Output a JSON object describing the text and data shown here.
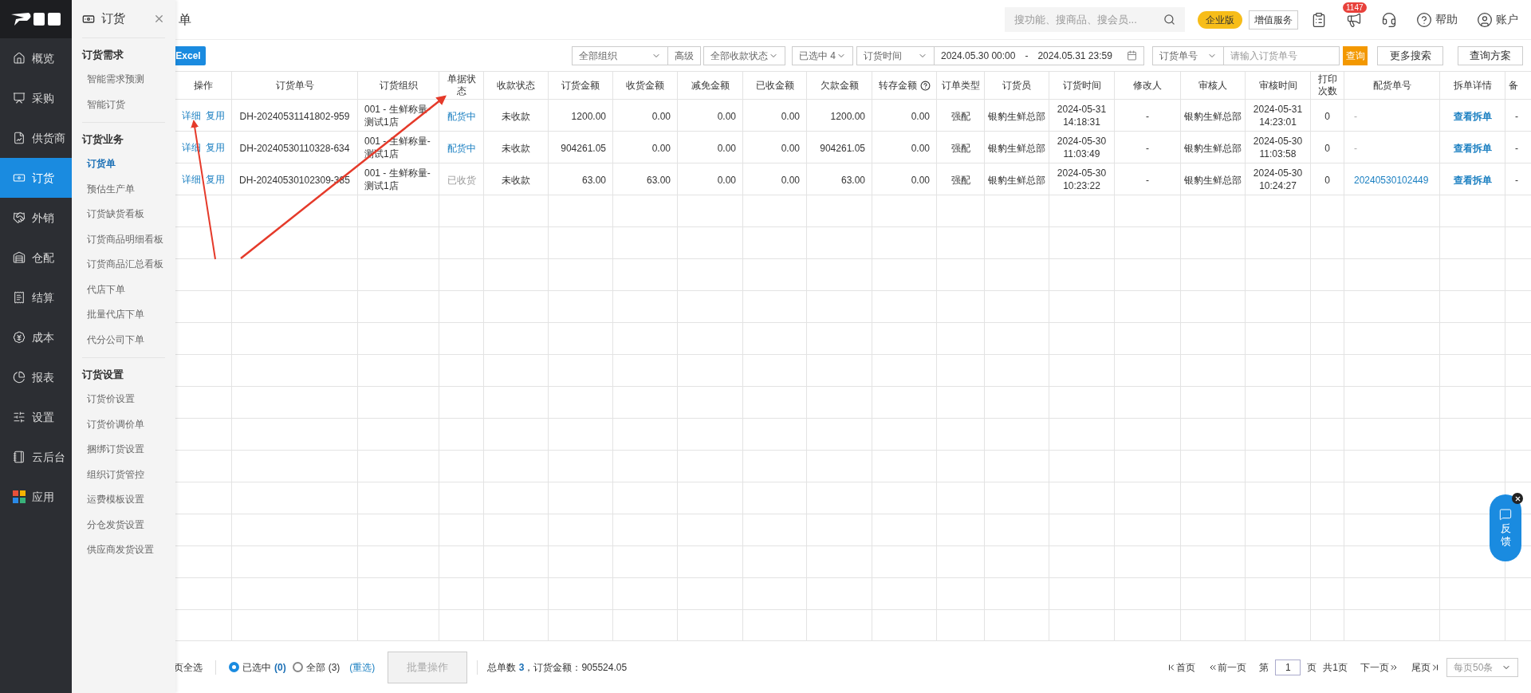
{
  "sidebar": {
    "items": [
      {
        "label": "概览",
        "selected": false
      },
      {
        "label": "采购",
        "selected": false
      },
      {
        "label": "供货商",
        "selected": false
      },
      {
        "label": "订货",
        "selected": true
      },
      {
        "label": "外销",
        "selected": false
      },
      {
        "label": "仓配",
        "selected": false
      },
      {
        "label": "结算",
        "selected": false
      },
      {
        "label": "成本",
        "selected": false
      },
      {
        "label": "报表",
        "selected": false
      },
      {
        "label": "设置",
        "selected": false
      },
      {
        "label": "云后台",
        "selected": false
      },
      {
        "label": "应用",
        "selected": false
      }
    ]
  },
  "flyout": {
    "title": "订货",
    "sections": [
      {
        "title": "订货需求",
        "items": [
          {
            "label": "智能需求预测",
            "selected": false
          },
          {
            "label": "智能订货",
            "selected": false
          }
        ]
      },
      {
        "title": "订货业务",
        "items": [
          {
            "label": "订货单",
            "selected": true
          },
          {
            "label": "预估生产单",
            "selected": false
          },
          {
            "label": "订货缺货看板",
            "selected": false
          },
          {
            "label": "订货商品明细看板",
            "selected": false
          },
          {
            "label": "订货商品汇总看板",
            "selected": false
          },
          {
            "label": "代店下单",
            "selected": false
          },
          {
            "label": "批量代店下单",
            "selected": false
          },
          {
            "label": "代分公司下单",
            "selected": false
          }
        ]
      },
      {
        "title": "订货设置",
        "items": [
          {
            "label": "订货价设置",
            "selected": false
          },
          {
            "label": "订货价调价单",
            "selected": false
          },
          {
            "label": "捆绑订货设置",
            "selected": false
          },
          {
            "label": "组织订货管控",
            "selected": false
          },
          {
            "label": "运费模板设置",
            "selected": false
          },
          {
            "label": "分仓发货设置",
            "selected": false
          },
          {
            "label": "供应商发货设置",
            "selected": false
          }
        ]
      }
    ]
  },
  "page_title": "单",
  "topbar": {
    "search_placeholder": "搜功能、搜商品、搜会员...",
    "edition": "企业版",
    "value_added": "增值服务",
    "notice_count": "1147",
    "help": "帮助",
    "account": "账户"
  },
  "filters": {
    "excel": "Excel",
    "org": "全部组织",
    "advanced": "高级",
    "pay_status": "全部收款状态",
    "doc_status": "已选中 4",
    "time_type": "订货时间",
    "date_from": "2024.05.30 00:00",
    "date_sep": "-",
    "date_to": "2024.05.31 23:59",
    "no_type": "订货单号",
    "no_placeholder": "请输入订货单号",
    "query": "查询",
    "more": "更多搜索",
    "scheme": "查询方案"
  },
  "table": {
    "columns": [
      "操作",
      "订货单号",
      "订货组织",
      "单据状态",
      "收款状态",
      "订货金额",
      "收货金额",
      "减免金额",
      "已收金额",
      "欠款金额",
      "转存金额",
      "订单类型",
      "订货员",
      "订货时间",
      "修改人",
      "审核人",
      "审核时间",
      "打印次数",
      "配货单号",
      "拆单详情",
      "备"
    ],
    "rows": [
      {
        "actions": [
          "详细",
          "复用"
        ],
        "order_no": "DH-20240531141802-959",
        "org": "001 - 生鲜称量-测试1店",
        "status": {
          "text": "配货中",
          "kind": "active"
        },
        "pay_status": "未收款",
        "order_amount": "1200.00",
        "received_amount": "0.00",
        "discount": "0.00",
        "paid": "0.00",
        "owed": "1200.00",
        "transfer": "0.00",
        "type": "强配",
        "orderer": "银豹生鲜总部",
        "order_time": "2024-05-31 14:18:31",
        "modifier": "-",
        "auditor": "银豹生鲜总部",
        "audit_time": "2024-05-31 14:23:01",
        "prints": "0",
        "dispatch_no": {
          "text": "-",
          "link": false
        },
        "split": "查看拆单",
        "note": "-"
      },
      {
        "actions": [
          "详细",
          "复用"
        ],
        "order_no": "DH-20240530110328-634",
        "org": "001 - 生鲜称量-测试1店",
        "status": {
          "text": "配货中",
          "kind": "active"
        },
        "pay_status": "未收款",
        "order_amount": "904261.05",
        "received_amount": "0.00",
        "discount": "0.00",
        "paid": "0.00",
        "owed": "904261.05",
        "transfer": "0.00",
        "type": "强配",
        "orderer": "银豹生鲜总部",
        "order_time": "2024-05-30 11:03:49",
        "modifier": "-",
        "auditor": "银豹生鲜总部",
        "audit_time": "2024-05-30 11:03:58",
        "prints": "0",
        "dispatch_no": {
          "text": "-",
          "link": false
        },
        "split": "查看拆单",
        "note": "-"
      },
      {
        "actions": [
          "详细",
          "复用"
        ],
        "order_no": "DH-20240530102309-385",
        "org": "001 - 生鲜称量-测试1店",
        "status": {
          "text": "已收货",
          "kind": "done"
        },
        "pay_status": "未收款",
        "order_amount": "63.00",
        "received_amount": "63.00",
        "discount": "0.00",
        "paid": "0.00",
        "owed": "63.00",
        "transfer": "0.00",
        "type": "强配",
        "orderer": "银豹生鲜总部",
        "order_time": "2024-05-30 10:23:22",
        "modifier": "-",
        "auditor": "银豹生鲜总部",
        "audit_time": "2024-05-30 10:24:27",
        "prints": "0",
        "dispatch_no": {
          "text": "20240530102449",
          "link": true
        },
        "split": "查看拆单",
        "note": "-"
      }
    ]
  },
  "footer": {
    "select_page": "页全选",
    "radios": [
      {
        "label": "已选中",
        "count": "(0)",
        "selected": true
      },
      {
        "label": "全部",
        "count": "(3)",
        "selected": false
      }
    ],
    "reselect": "(重选)",
    "batch": "批量操作",
    "batch_disabled": true,
    "summary_label": "总单数",
    "summary_count": "3",
    "summary_amount": "，订货金额：905524.05"
  },
  "pager": {
    "first": "首页",
    "prev": "前一页",
    "page_prefix": "第",
    "page": "1",
    "page_suffix": "页",
    "total": "共1页",
    "next": "下一页",
    "last": "尾页",
    "per_page": "每页50条"
  },
  "feedback": "反馈"
}
